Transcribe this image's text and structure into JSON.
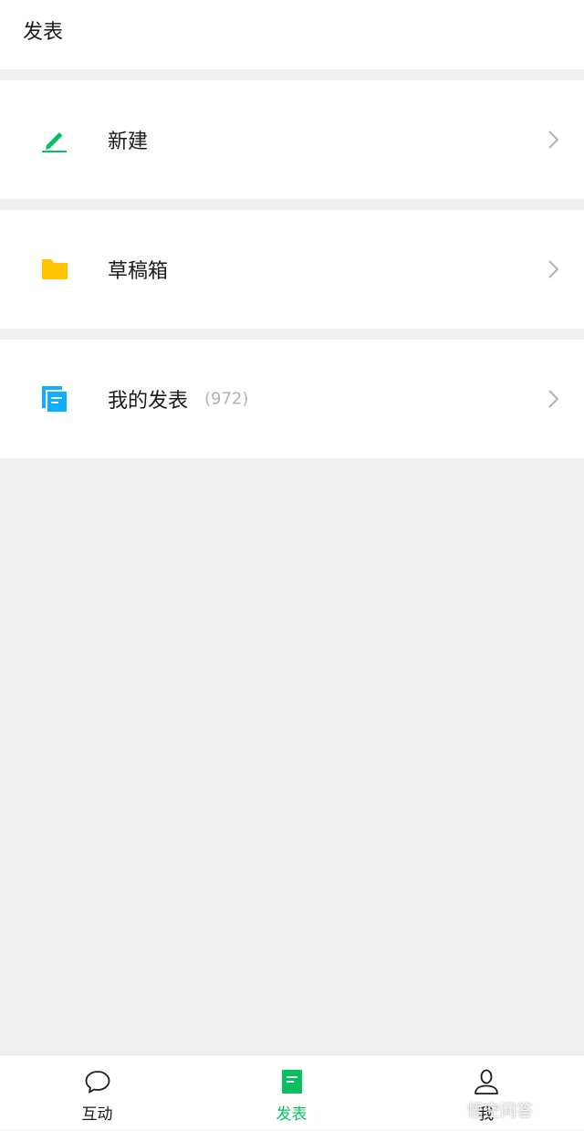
{
  "header": {
    "title": "发表"
  },
  "menu": [
    {
      "label": "新建",
      "icon": "pencil-icon",
      "color": "#07c160"
    },
    {
      "label": "草稿箱",
      "icon": "folder-icon",
      "color": "#ffc300"
    },
    {
      "label": "我的发表",
      "count": "(972)",
      "icon": "documents-icon",
      "color": "#10aeff"
    }
  ],
  "tabs": [
    {
      "label": "互动",
      "icon": "chat-bubble-icon",
      "active": false
    },
    {
      "label": "发表",
      "icon": "document-icon",
      "active": true
    },
    {
      "label": "我",
      "icon": "person-icon",
      "active": false
    }
  ],
  "colors": {
    "accent": "#07c160",
    "background": "#f0f0f0"
  },
  "watermark": "悟空问答"
}
